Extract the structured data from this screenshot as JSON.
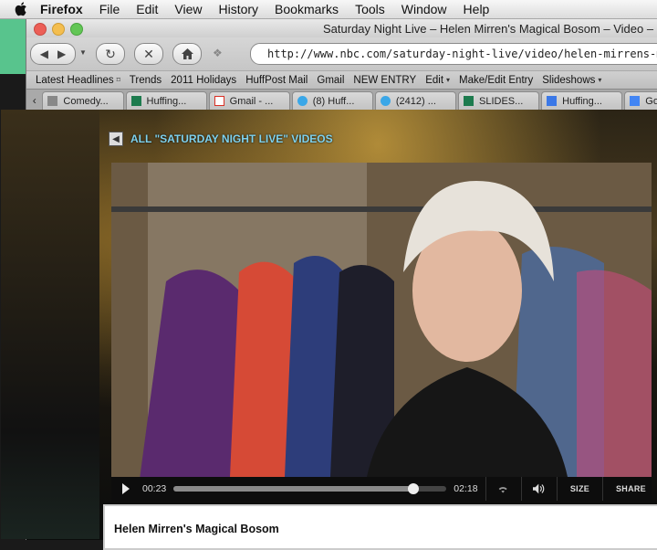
{
  "menubar": {
    "app": "Firefox",
    "items": [
      "File",
      "Edit",
      "View",
      "History",
      "Bookmarks",
      "Tools",
      "Window",
      "Help"
    ]
  },
  "window": {
    "title": "Saturday Night Live – Helen Mirren's Magical Bosom – Video –",
    "url": "http://www.nbc.com/saturday-night-live/video/helen-mirrens-magical-bo"
  },
  "bookmarks": [
    {
      "label": "Latest Headlines",
      "suffix": "⌑"
    },
    {
      "label": "Trends",
      "suffix": ""
    },
    {
      "label": "2011 Holidays",
      "suffix": ""
    },
    {
      "label": "HuffPost Mail",
      "suffix": ""
    },
    {
      "label": "Gmail",
      "suffix": ""
    },
    {
      "label": "NEW ENTRY",
      "suffix": ""
    },
    {
      "label": "Edit",
      "suffix": "▾"
    },
    {
      "label": "Make/Edit Entry",
      "suffix": ""
    },
    {
      "label": "Slideshows",
      "suffix": "▾"
    }
  ],
  "tabs": [
    {
      "label": "Comedy...",
      "icon": "page-icon",
      "color": "#888888"
    },
    {
      "label": "Huffing...",
      "icon": "huffpost-icon",
      "color": "#1d7b4e"
    },
    {
      "label": "Gmail - ...",
      "icon": "gmail-icon",
      "color": "#d93025"
    },
    {
      "label": "(8) Huff...",
      "icon": "twitter-icon",
      "color": "#3aa7e8"
    },
    {
      "label": "(2412) ...",
      "icon": "twitter-icon",
      "color": "#3aa7e8"
    },
    {
      "label": "SLIDES...",
      "icon": "huffpost-icon",
      "color": "#1d7b4e"
    },
    {
      "label": "Huffing...",
      "icon": "calendar-icon",
      "color": "#3b78e7"
    },
    {
      "label": "Goo",
      "icon": "google-icon",
      "color": "#4285f4"
    }
  ],
  "page": {
    "back_link": "ALL \"SATURDAY NIGHT LIVE\" VIDEOS",
    "video_title": "Helen Mirren's Magical Bosom"
  },
  "player": {
    "current_time": "00:23",
    "duration": "02:18",
    "progress": 0.88,
    "size_label": "SIZE",
    "share_label": "SHARE"
  },
  "colors": {
    "back_link": "#7fd2ee",
    "control_bar": "#0d0d0d"
  }
}
